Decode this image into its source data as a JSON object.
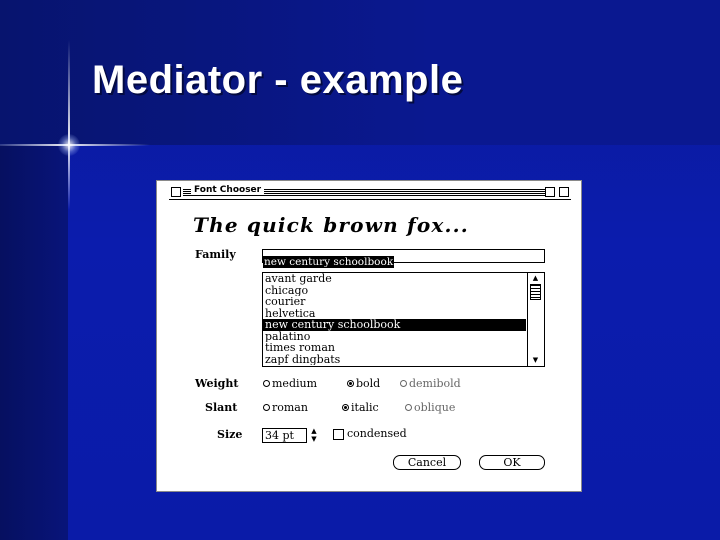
{
  "slide": {
    "title": "Mediator - example"
  },
  "dialog": {
    "window_title": "Font Chooser",
    "preview_text": "The quick brown fox...",
    "family": {
      "label": "Family",
      "value": "new century schoolbook",
      "options": [
        "avant garde",
        "chicago",
        "courier",
        "helvetica",
        "new century schoolbook",
        "palatino",
        "times roman",
        "zapf dingbats"
      ],
      "selected_index": 4
    },
    "weight": {
      "label": "Weight",
      "options": [
        "medium",
        "bold",
        "demibold"
      ],
      "selected": "bold"
    },
    "slant": {
      "label": "Slant",
      "options": [
        "roman",
        "italic",
        "oblique"
      ],
      "selected": "italic"
    },
    "size": {
      "label": "Size",
      "value": "34 pt"
    },
    "condensed": {
      "label": "condensed",
      "checked": false
    },
    "buttons": {
      "cancel": "Cancel",
      "ok": "OK"
    }
  },
  "colors": {
    "slide_background": "#0a1ba8",
    "title_text": "#ffffff",
    "dialog_background": "#ffffff"
  }
}
